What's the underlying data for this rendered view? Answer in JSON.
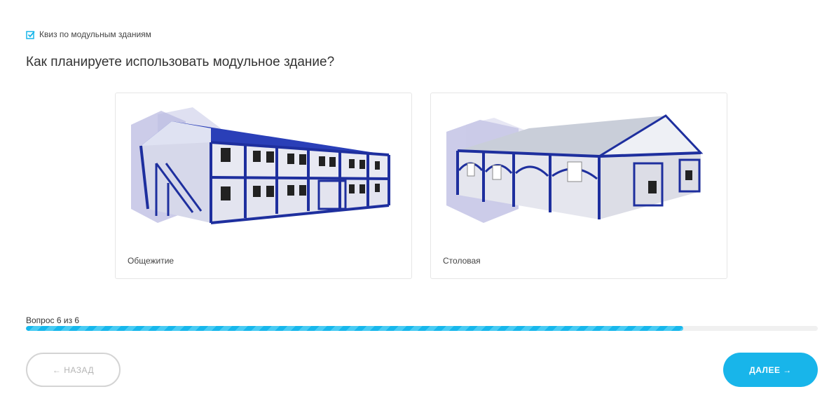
{
  "header": {
    "tag_label": "Квиз по модульным зданиям",
    "icon": "checkbox-icon"
  },
  "question": {
    "title": "Как планируете использовать модульное здание?"
  },
  "options": [
    {
      "label": "Общежитие",
      "image": "two-story-modular-dormitory"
    },
    {
      "label": "Столовая",
      "image": "one-story-modular-canteen"
    }
  ],
  "progress": {
    "label": "Вопрос 6 из 6",
    "fraction": 0.83
  },
  "nav": {
    "back_label": "← НАЗАД",
    "next_label": "ДАЛЕЕ →"
  },
  "colors": {
    "accent": "#18b5ea",
    "building_blue": "#1e2f9e"
  }
}
